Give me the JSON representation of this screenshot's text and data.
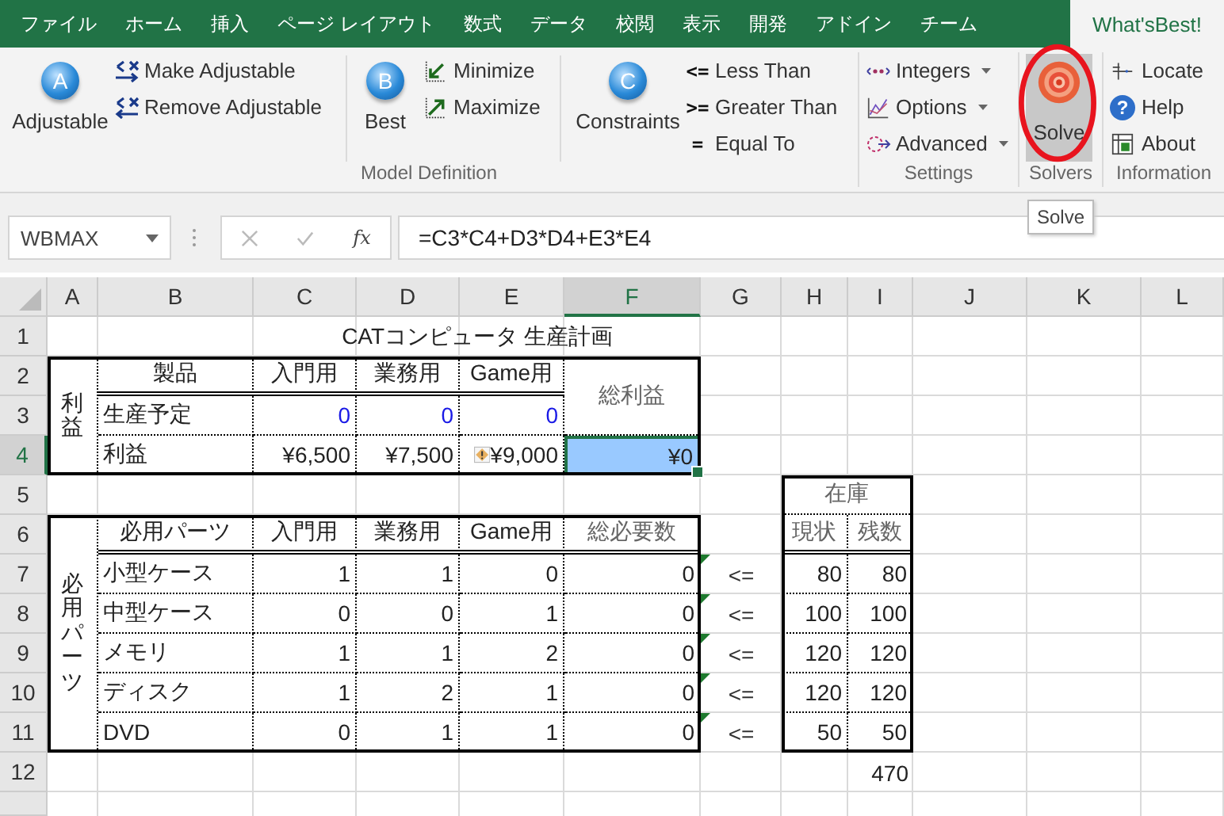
{
  "tabs": [
    {
      "label": "ファイル",
      "selected": false
    },
    {
      "label": "ホーム",
      "selected": false
    },
    {
      "label": "挿入",
      "selected": false
    },
    {
      "label": "ページ レイアウト",
      "selected": false
    },
    {
      "label": "数式",
      "selected": false
    },
    {
      "label": "データ",
      "selected": false
    },
    {
      "label": "校閲",
      "selected": false
    },
    {
      "label": "表示",
      "selected": false
    },
    {
      "label": "開発",
      "selected": false
    },
    {
      "label": "アドイン",
      "selected": false
    },
    {
      "label": "チーム",
      "selected": false
    },
    {
      "label": "What'sBest!",
      "selected": true
    }
  ],
  "ribbon": {
    "model_definition": {
      "label": "Model Definition",
      "adjustable": {
        "label": "Adjustable",
        "badge": "A"
      },
      "make_adjustable": "Make Adjustable",
      "remove_adjustable": "Remove Adjustable",
      "best": {
        "label": "Best",
        "badge": "B"
      },
      "minimize": "Minimize",
      "maximize": "Maximize",
      "constraints": {
        "label": "Constraints",
        "badge": "C"
      },
      "relations": [
        {
          "symbol": "<=",
          "label": "Less Than"
        },
        {
          "symbol": ">=",
          "label": "Greater Than"
        },
        {
          "symbol": "=",
          "label": "Equal To"
        }
      ]
    },
    "settings": {
      "label": "Settings",
      "items": [
        {
          "label": "Integers",
          "dropdown": true
        },
        {
          "label": "Options",
          "dropdown": true
        },
        {
          "label": "Advanced",
          "dropdown": true
        }
      ]
    },
    "solvers": {
      "label": "Solvers",
      "solve": {
        "label": "Solve",
        "hovered": true,
        "circled": true,
        "tooltip": "Solve"
      }
    },
    "information": {
      "label": "Information",
      "items": [
        {
          "label": "Locate"
        },
        {
          "label": "Help",
          "symbol": "?"
        },
        {
          "label": "About"
        }
      ]
    }
  },
  "formula_bar": {
    "name_box": "WBMAX",
    "function_label": "fx",
    "formula": "=C3*C4+D3*D4+E3*E4"
  },
  "sheet": {
    "columns": [
      {
        "label": "A",
        "selected": false
      },
      {
        "label": "B",
        "selected": false
      },
      {
        "label": "C",
        "selected": false
      },
      {
        "label": "D",
        "selected": false
      },
      {
        "label": "E",
        "selected": false
      },
      {
        "label": "F",
        "selected": true
      },
      {
        "label": "G",
        "selected": false
      },
      {
        "label": "H",
        "selected": false
      },
      {
        "label": "I",
        "selected": false
      },
      {
        "label": "J",
        "selected": false
      },
      {
        "label": "K",
        "selected": false
      },
      {
        "label": "L",
        "selected": false
      }
    ],
    "row_numbers": [
      {
        "label": "1",
        "selected": false
      },
      {
        "label": "2",
        "selected": false
      },
      {
        "label": "3",
        "selected": false
      },
      {
        "label": "4",
        "selected": true
      },
      {
        "label": "5",
        "selected": false
      },
      {
        "label": "6",
        "selected": false
      },
      {
        "label": "7",
        "selected": false
      },
      {
        "label": "8",
        "selected": false
      },
      {
        "label": "9",
        "selected": false
      },
      {
        "label": "10",
        "selected": false
      },
      {
        "label": "11",
        "selected": false
      },
      {
        "label": "12",
        "selected": false
      }
    ],
    "title": "CATコンピュータ 生産計画",
    "profit_table": {
      "side_label": "利益",
      "headers": [
        "製品",
        "入門用",
        "業務用",
        "Game用"
      ],
      "rows": [
        {
          "label": "生産予定",
          "values": [
            "0",
            "0",
            "0"
          ],
          "adjustable": true,
          "warning": false
        },
        {
          "label": "利益",
          "values": [
            "¥6,500",
            "¥7,500",
            "¥9,000"
          ],
          "adjustable": false,
          "warning": true
        }
      ],
      "total": {
        "header": "総利益",
        "value": "¥0",
        "selected": true
      }
    },
    "parts_table": {
      "side_label": "必用パーツ",
      "headers": [
        "必用パーツ",
        "入門用",
        "業務用",
        "Game用",
        "総必要数"
      ],
      "rows": [
        {
          "name": "小型ケース",
          "values": [
            "1",
            "1",
            "0"
          ],
          "total": "0",
          "flagged": true,
          "operator": "<=",
          "current": "80",
          "remaining": "80"
        },
        {
          "name": "中型ケース",
          "values": [
            "0",
            "0",
            "1"
          ],
          "total": "0",
          "flagged": true,
          "operator": "<=",
          "current": "100",
          "remaining": "100"
        },
        {
          "name": "メモリ",
          "values": [
            "1",
            "1",
            "2"
          ],
          "total": "0",
          "flagged": true,
          "operator": "<=",
          "current": "120",
          "remaining": "120"
        },
        {
          "name": "ディスク",
          "values": [
            "1",
            "2",
            "1"
          ],
          "total": "0",
          "flagged": true,
          "operator": "<=",
          "current": "120",
          "remaining": "120"
        },
        {
          "name": "DVD",
          "values": [
            "0",
            "1",
            "1"
          ],
          "total": "0",
          "flagged": true,
          "operator": "<=",
          "current": "50",
          "remaining": "50"
        }
      ]
    },
    "stock": {
      "header": "在庫",
      "subheaders": [
        "現状",
        "残数"
      ],
      "total": "470"
    }
  }
}
